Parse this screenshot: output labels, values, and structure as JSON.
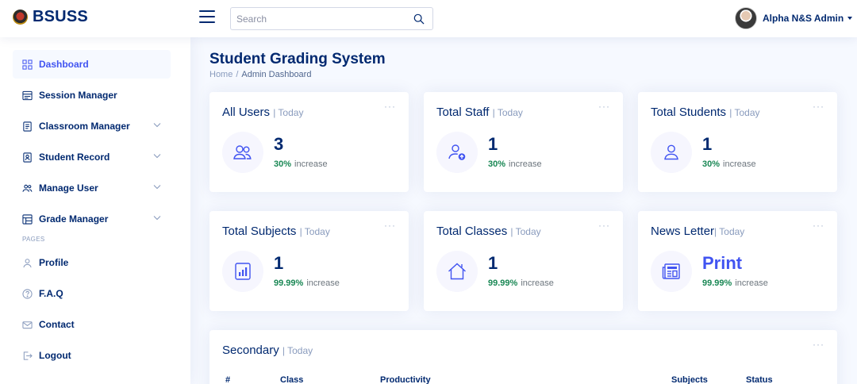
{
  "brand": {
    "name": "BSUSS"
  },
  "header": {
    "search_placeholder": "Search",
    "user_name": "Alpha N&S Admin"
  },
  "sidebar": {
    "items": [
      {
        "label": "Dashboard",
        "icon": "grid-icon",
        "active": true,
        "expandable": false
      },
      {
        "label": "Session Manager",
        "icon": "session-icon",
        "active": false,
        "expandable": false
      },
      {
        "label": "Classroom Manager",
        "icon": "classroom-icon",
        "active": false,
        "expandable": true
      },
      {
        "label": "Student Record",
        "icon": "student-record-icon",
        "active": false,
        "expandable": true
      },
      {
        "label": "Manage User",
        "icon": "people-icon",
        "active": false,
        "expandable": true
      },
      {
        "label": "Grade Manager",
        "icon": "grade-icon",
        "active": false,
        "expandable": true
      }
    ],
    "pages_heading": "PAGES",
    "pages": [
      {
        "label": "Profile",
        "icon": "person-icon"
      },
      {
        "label": "F.A.Q",
        "icon": "question-circle-icon"
      },
      {
        "label": "Contact",
        "icon": "envelope-icon"
      },
      {
        "label": "Logout",
        "icon": "logout-icon"
      }
    ]
  },
  "main": {
    "title": "Student Grading System",
    "breadcrumb": {
      "home": "Home",
      "separator": "/",
      "current": "Admin Dashboard"
    },
    "cards": [
      {
        "title": "All Users",
        "period": "| Today",
        "value": "3",
        "percent": "30%",
        "trend": "increase",
        "icon": "people-icon"
      },
      {
        "title": "Total Staff",
        "period": "| Today",
        "value": "1",
        "percent": "30%",
        "trend": "increase",
        "icon": "person-up-icon"
      },
      {
        "title": "Total Students",
        "period": "| Today",
        "value": "1",
        "percent": "30%",
        "trend": "increase",
        "icon": "person-icon"
      },
      {
        "title": "Total Subjects",
        "period": "| Today",
        "value": "1",
        "percent": "99.99%",
        "trend": "increase",
        "icon": "bar-chart-icon"
      },
      {
        "title": "Total Classes",
        "period": "| Today",
        "value": "1",
        "percent": "99.99%",
        "trend": "increase",
        "icon": "house-icon"
      },
      {
        "title": "News Letter",
        "period": "| Today",
        "value": "Print",
        "percent": "99.99%",
        "trend": "increase",
        "icon": "newspaper-icon"
      }
    ],
    "secondary": {
      "title": "Secondary",
      "period": "| Today",
      "columns": [
        "#",
        "Class",
        "Productivity",
        "Subjects",
        "Status"
      ]
    }
  },
  "colors": {
    "primary": "#4154f1",
    "navy": "#012970",
    "muted": "#899bbd",
    "success": "#198754",
    "background": "#f6f9ff"
  }
}
